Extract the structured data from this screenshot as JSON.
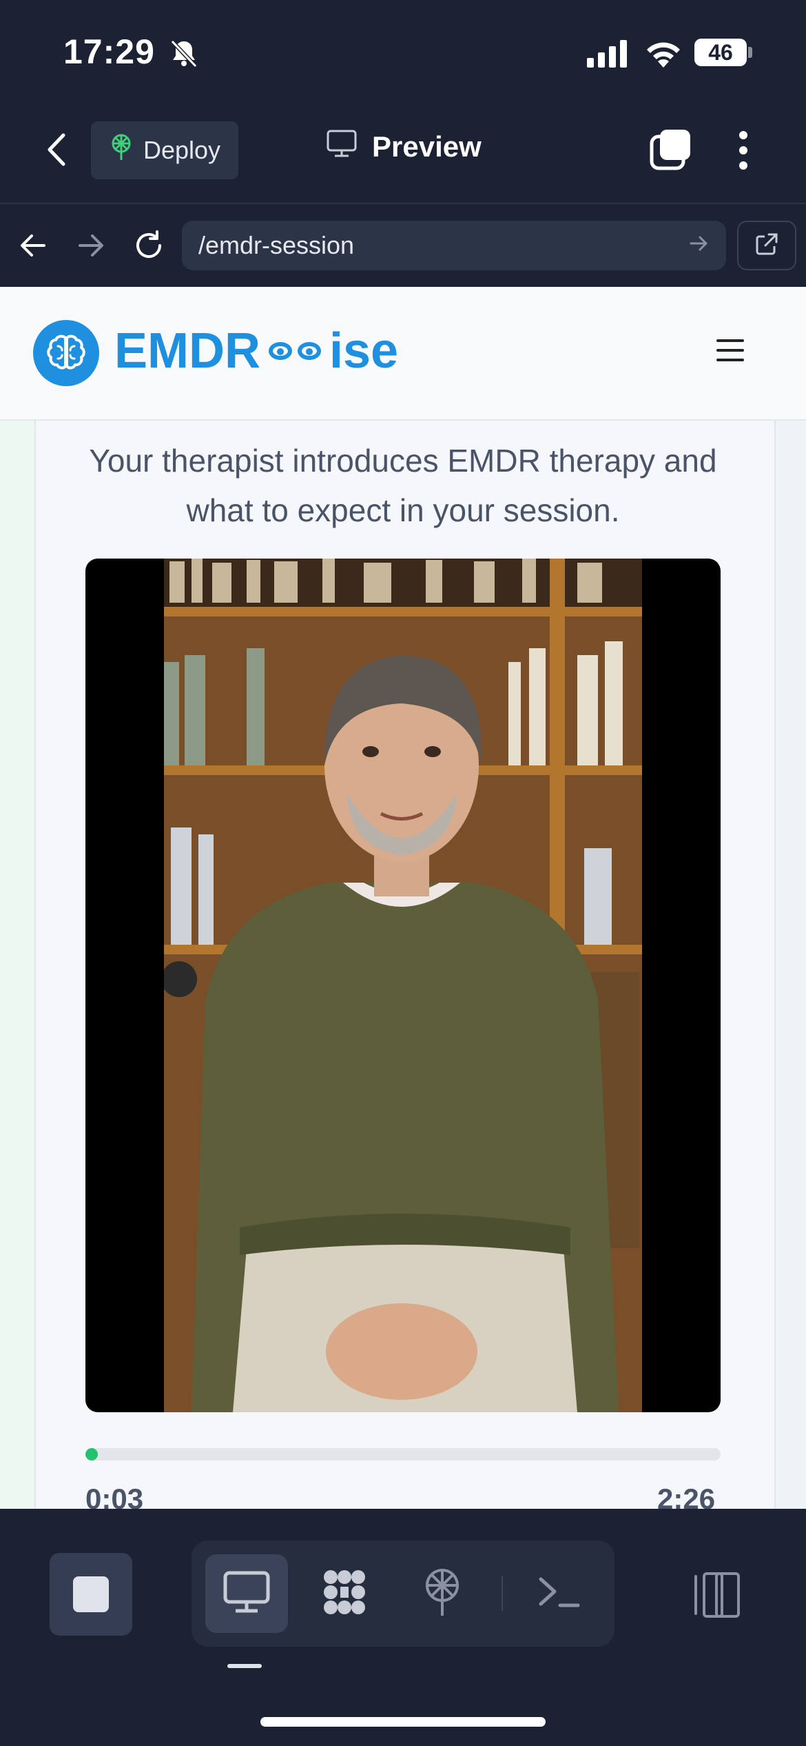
{
  "status_bar": {
    "time": "17:29",
    "battery": "46",
    "icons": [
      "bell-slash-icon",
      "signal-icon",
      "wifi-icon",
      "battery-icon"
    ]
  },
  "nav": {
    "deploy_label": "Deploy",
    "preview_label": "Preview",
    "icons": [
      "back-chevron-icon",
      "deploy-icon",
      "monitor-icon",
      "tabs-icon",
      "more-vertical-icon"
    ]
  },
  "url_bar": {
    "url": "/emdr-session",
    "icons": [
      "back-arrow-icon",
      "forward-arrow-icon",
      "reload-icon",
      "go-arrow-icon",
      "external-link-icon"
    ]
  },
  "app": {
    "brand_prefix": "EMDR",
    "brand_suffix": "ise",
    "intro_text": "Your therapist introduces EMDR therapy and what to expect in your session.",
    "video": {
      "current_time": "0:03",
      "duration": "2:26",
      "progress_fraction": 0.02
    }
  },
  "toolbar": {
    "items": [
      "stop",
      "preview",
      "components",
      "deploy",
      "terminal",
      "panels"
    ],
    "active": "preview"
  },
  "colors": {
    "brand_blue": "#1f8fe0",
    "progress_green": "#22c26f",
    "chrome_dark": "#1c2233"
  }
}
